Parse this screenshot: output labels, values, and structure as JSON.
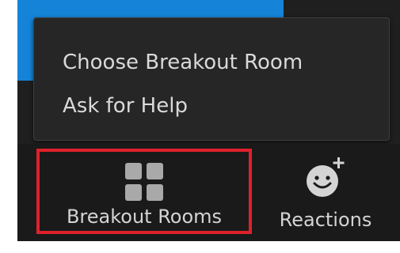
{
  "popup_menu": {
    "items": [
      {
        "label": "Choose Breakout Room"
      },
      {
        "label": "Ask for Help"
      }
    ]
  },
  "toolbar": {
    "buttons": [
      {
        "label": "Breakout Rooms",
        "icon": "grid-icon",
        "highlighted": true,
        "highlight_color": "#e0212b"
      },
      {
        "label": "Reactions",
        "icon": "smiley-add-icon"
      }
    ]
  },
  "colors": {
    "background_dark": "#1f1f1f",
    "menu_background": "#262626",
    "accent_blue": "#1584d8",
    "text": "#d9d9d9",
    "highlight_red": "#e0212b"
  }
}
